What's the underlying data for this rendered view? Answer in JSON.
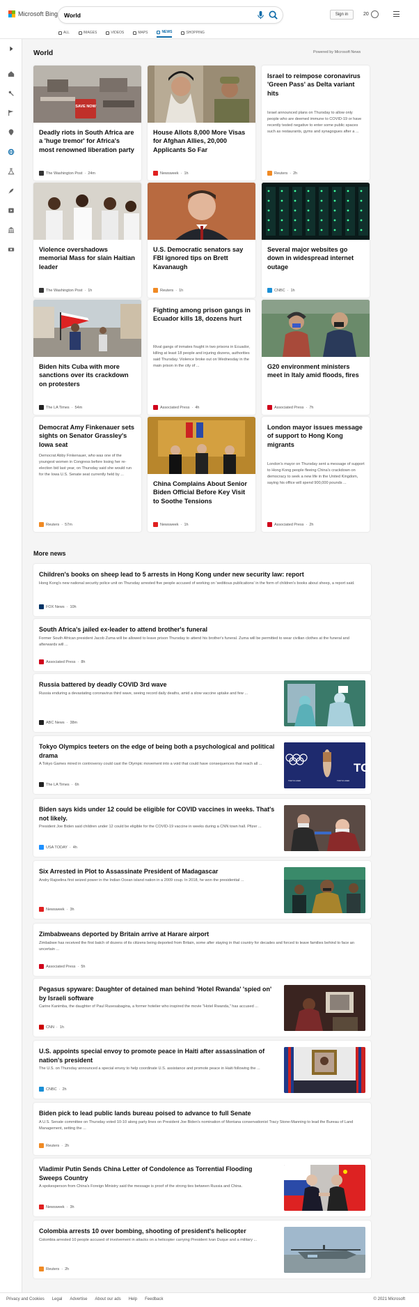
{
  "header": {
    "logo_text": "Microsoft Bing",
    "search_value": "World",
    "sign_in": "Sign in",
    "rewards_count": "20",
    "colors": {
      "logo_red": "#f25022",
      "logo_green": "#7fba00",
      "logo_blue": "#00a4ef",
      "logo_yellow": "#ffb900",
      "accent": "#0c6ba9"
    }
  },
  "scopes": [
    {
      "label": "ALL",
      "icon": "search-icon",
      "active": false
    },
    {
      "label": "IMAGES",
      "icon": "image-icon",
      "active": false
    },
    {
      "label": "VIDEOS",
      "icon": "video-icon",
      "active": false
    },
    {
      "label": "MAPS",
      "icon": "map-pin-icon",
      "active": false
    },
    {
      "label": "NEWS",
      "icon": "news-icon",
      "active": true
    },
    {
      "label": "SHOPPING",
      "icon": "tag-icon",
      "active": false
    }
  ],
  "sidebar": [
    "expand-icon",
    "home-icon",
    "sports-icon",
    "flag-icon",
    "location-icon",
    "globe-icon",
    "science-icon",
    "rocket-icon",
    "entertainment-icon",
    "building-icon",
    "money-icon"
  ],
  "main": {
    "title": "World",
    "powered_by": "Powered by Microsoft News"
  },
  "top_stories": [
    {
      "title": "Deadly riots in South Africa are a 'huge tremor' for Africa's most renowned liberation party",
      "source": "The Washington Post",
      "time": "24m",
      "logo_color": "#333"
    },
    {
      "title": "House Allots 8,000 More Visas for Afghan Allies, 20,000 Applicants So Far",
      "source": "Newsweek",
      "time": "1h",
      "logo_color": "#e02020"
    },
    {
      "title": "Israel to reimpose coronavirus 'Green Pass' as Delta variant hits",
      "snippet": "Israel announced plans on Thursday to allow only people who are deemed immune to COVID-19 or have recently tested negative to enter some public spaces such as restaurants, gyms and synagogues after a ...",
      "source": "Reuters",
      "time": "2h",
      "logo_color": "#f08a24"
    },
    {
      "title": "Violence overshadows memorial Mass for slain Haitian leader",
      "source": "The Washington Post",
      "time": "1h",
      "logo_color": "#333"
    },
    {
      "title": "U.S. Democratic senators say FBI ignored tips on Brett Kavanaugh",
      "source": "Reuters",
      "time": "1h",
      "logo_color": "#f08a24"
    },
    {
      "title": "Several major websites go down in widespread internet outage",
      "source": "CNBC",
      "time": "1h",
      "logo_color": "#1a8fd6"
    },
    {
      "title": "Biden hits Cuba with more sanctions over its crackdown on protesters",
      "source": "The LA Times",
      "time": "54m",
      "logo_color": "#222"
    },
    {
      "title": "Fighting among prison gangs in Ecuador kills 18, dozens hurt",
      "snippet": "Rival gangs of inmates fought in two prisons in Ecuador, killing at least 18 people and injuring dozens, authorities said Thursday. Violence broke out on Wednesday in the main prison in the city of ...",
      "source": "Associated Press",
      "time": "4h",
      "logo_color": "#d0021b"
    },
    {
      "title": "G20 environment ministers meet in Italy amid floods, fires",
      "source": "Associated Press",
      "time": "7h",
      "logo_color": "#d0021b"
    },
    {
      "title": "Democrat Amy Finkenauer sets sights on Senator Grassley's Iowa seat",
      "snippet": "Democrat Abby Finkenauer, who was one of the youngest women in Congress before losing her re-election bid last year, on Thursday said she would run for the Iowa U.S. Senate seat currently held by ...",
      "source": "Reuters",
      "time": "57m",
      "logo_color": "#f08a24"
    },
    {
      "title": "China Complains About Senior Biden Official Before Key Visit to Soothe Tensions",
      "source": "Newsweek",
      "time": "1h",
      "logo_color": "#e02020"
    },
    {
      "title": "London mayor issues message of support to Hong Kong migrants",
      "snippet": "London's mayor on Thursday sent a message of support to Hong Kong people fleeing China's crackdown on democracy to seek a new life in the United Kingdom, saying his office will spend 900,000 pounds ...",
      "source": "Associated Press",
      "time": "2h",
      "logo_color": "#d0021b"
    }
  ],
  "save_now_sign": "SAVE NOW",
  "more_news": {
    "title": "More news",
    "items": [
      {
        "title": "Children's books on sheep lead to 5 arrests in Hong Kong under new security law: report",
        "snippet": "Hong Kong's new national security police unit on Thursday arrested five people accused of working on 'seditious publications' in the form of children's books about sheep, a report said.",
        "source": "FOX News",
        "time": "10h",
        "logo_color": "#003366"
      },
      {
        "title": "South Africa's jailed ex-leader to attend brother's funeral",
        "snippet": "Former South African president Jacob Zuma will be allowed to leave prison Thursday to attend his brother's funeral. Zuma will be permitted to wear civilian clothes at the funeral and afterwards will ...",
        "source": "Associated Press",
        "time": "8h",
        "logo_color": "#d0021b"
      },
      {
        "title": "Russia battered by deadly COVID 3rd wave",
        "snippet": "Russia enduring a devastating coronavirus third wave, seeing record daily deaths, amid a slow vaccine uptake and few ...",
        "source": "ABC News",
        "time": "38m",
        "logo_color": "#222"
      },
      {
        "title": "Tokyo Olympics teeters on the edge of being both a psychological and political drama",
        "snippet": "A Tokyo Games mired in controversy could cast the Olympic movement into a void that could have consequences that reach all ...",
        "source": "The LA Times",
        "time": "6h",
        "logo_color": "#222",
        "img_text": "TO",
        "img_caption": "TOKYO 2020"
      },
      {
        "title": "Biden says kids under 12 could be eligible for COVID vaccines in weeks. That's not likely.",
        "snippet": "President Joe Biden said children under 12 could be eligible for the COVID-19 vaccine in weeks during a CNN town hall. Pfizer ...",
        "source": "USA TODAY",
        "time": "4h",
        "logo_color": "#1e90ff"
      },
      {
        "title": "Six Arrested in Plot to Assassinate President of Madagascar",
        "snippet": "Andry Rajoelina first seized power in the Indian Ocean island nation in a 2009 coup. In 2018, he won the presidential ...",
        "source": "Newsweek",
        "time": "3h",
        "logo_color": "#e02020"
      },
      {
        "title": "Zimbabweans deported by Britain arrive at Harare airport",
        "snippet": "Zimbabwe has received the first batch of dozens of its citizens being deported from Britain, some after staying in that country for decades and forced to leave families behind to face an uncertain ...",
        "source": "Associated Press",
        "time": "5h",
        "logo_color": "#d0021b"
      },
      {
        "title": "Pegasus spyware: Daughter of detained man behind 'Hotel Rwanda' 'spied on' by Israeli software",
        "snippet": "Carine Kanimba, the daughter of Paul Rusesabagina, a former hotelier who inspired the movie \"Hotel Rwanda,\" has accused ...",
        "source": "CNN",
        "time": "1h",
        "logo_color": "#cc0000"
      },
      {
        "title": "U.S. appoints special envoy to promote peace in Haiti after assassination of nation's president",
        "snippet": "The U.S. on Thursday announced a special envoy to help coordinate U.S. assistance and promote peace in Haiti following the ...",
        "source": "CNBC",
        "time": "2h",
        "logo_color": "#1a8fd6"
      },
      {
        "title": "Biden pick to lead public lands bureau poised to advance to full Senate",
        "snippet": "A U.S. Senate committee on Thursday voted 10-10 along party lines on President Joe Biden's nomination of Montana conservationist Tracy Stone-Manning to lead the Bureau of Land Management, setting the ...",
        "source": "Reuters",
        "time": "2h",
        "logo_color": "#f08a24"
      },
      {
        "title": "Vladimir Putin Sends China Letter of Condolence as Torrential Flooding Sweeps Country",
        "snippet": "A spokesperson from China's Foreign Ministry said the message is proof of the strong ties between Russia and China.",
        "source": "Newsweek",
        "time": "3h",
        "logo_color": "#e02020"
      },
      {
        "title": "Colombia arrests 10 over bombing, shooting of president's helicopter",
        "snippet": "Colombia arrested 10 people accused of involvement in attacks on a helicopter carrying President Ivan Duque and a military ...",
        "source": "Reuters",
        "time": "2h",
        "logo_color": "#f08a24"
      }
    ]
  },
  "footer": {
    "links": [
      "Privacy and Cookies",
      "Legal",
      "Advertise",
      "About our ads",
      "Help",
      "Feedback"
    ],
    "copyright": "© 2021 Microsoft"
  }
}
